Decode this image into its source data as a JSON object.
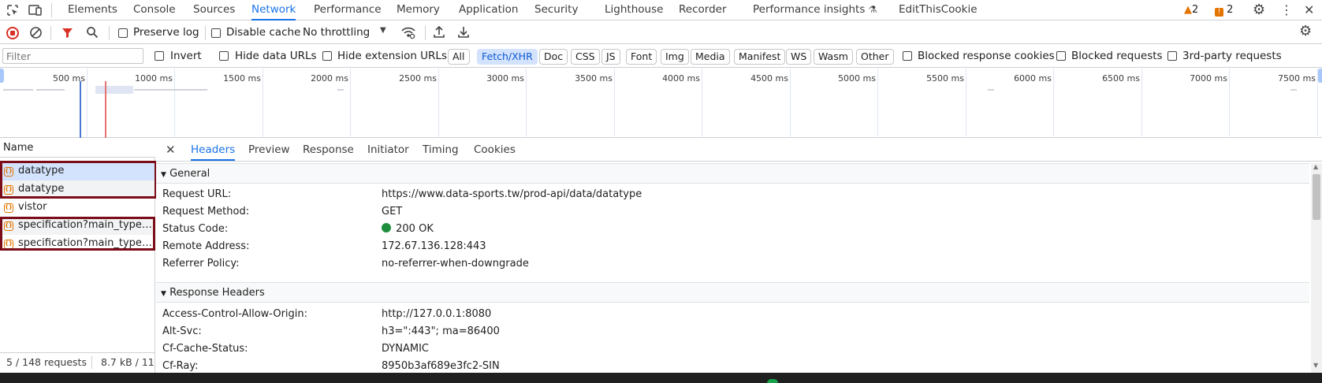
{
  "top_tabs": [
    "Elements",
    "Console",
    "Sources",
    "Network",
    "Performance",
    "Memory",
    "Application",
    "Security",
    "Lighthouse",
    "Recorder",
    "Performance insights",
    "EditThisCookie"
  ],
  "active_tab": "Network",
  "warnings_count": "2",
  "issues_count": "2",
  "toolbar": {
    "preserve_log": "Preserve log",
    "disable_cache": "Disable cache",
    "throttling": "No throttling"
  },
  "filter_bar": {
    "placeholder": "Filter",
    "invert": "Invert",
    "hide_data_urls": "Hide data URLs",
    "hide_extension_urls": "Hide extension URLs",
    "types": [
      "All",
      "Fetch/XHR",
      "Doc",
      "CSS",
      "JS",
      "Font",
      "Img",
      "Media",
      "Manifest",
      "WS",
      "Wasm",
      "Other"
    ],
    "selected_type": "Fetch/XHR",
    "blocked_response_cookies": "Blocked response cookies",
    "blocked_requests": "Blocked requests",
    "third_party_requests": "3rd-party requests"
  },
  "overview_ticks": [
    "500 ms",
    "1000 ms",
    "1500 ms",
    "2000 ms",
    "2500 ms",
    "3000 ms",
    "3500 ms",
    "4000 ms",
    "4500 ms",
    "5000 ms",
    "5500 ms",
    "6000 ms",
    "6500 ms",
    "7000 ms",
    "7500 ms"
  ],
  "request_list": {
    "header": "Name",
    "items": [
      "datatype",
      "datatype",
      "vistor",
      "specification?main_type=...",
      "specification?main_type=..."
    ],
    "status": "5 / 148 requests",
    "transfer": "8.7 kB / 11"
  },
  "detail_tabs": [
    "Headers",
    "Preview",
    "Response",
    "Initiator",
    "Timing",
    "Cookies"
  ],
  "active_detail_tab": "Headers",
  "general": {
    "title": "General",
    "rows": [
      {
        "key": "Request URL:",
        "value": "https://www.data-sports.tw/prod-api/data/datatype"
      },
      {
        "key": "Request Method:",
        "value": "GET"
      },
      {
        "key": "Status Code:",
        "value": "200 OK"
      },
      {
        "key": "Remote Address:",
        "value": "172.67.136.128:443"
      },
      {
        "key": "Referrer Policy:",
        "value": "no-referrer-when-downgrade"
      }
    ]
  },
  "response_headers": {
    "title": "Response Headers",
    "rows": [
      {
        "key": "Access-Control-Allow-Origin:",
        "value": "http://127.0.0.1:8080"
      },
      {
        "key": "Alt-Svc:",
        "value": "h3=\":443\"; ma=86400"
      },
      {
        "key": "Cf-Cache-Status:",
        "value": "DYNAMIC"
      },
      {
        "key": "Cf-Ray:",
        "value": "8950b3af689e3fc2-SIN"
      }
    ]
  },
  "colors": {
    "accent": "#1a73e8",
    "record": "#d93025",
    "highlight_box": "#7b0d18",
    "status_ok": "#1e8e3e",
    "warning": "#e37400"
  }
}
